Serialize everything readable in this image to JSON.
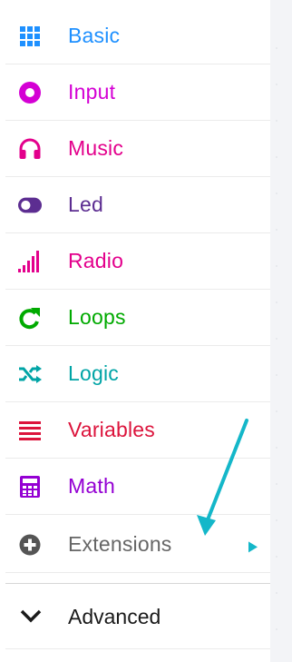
{
  "toolbox": {
    "categories": [
      {
        "label": "Basic",
        "color": "#1e90ff",
        "icon": "grid-icon"
      },
      {
        "label": "Input",
        "color": "#d400d4",
        "icon": "input-circle-icon"
      },
      {
        "label": "Music",
        "color": "#e3008c",
        "icon": "headphones-icon"
      },
      {
        "label": "Led",
        "color": "#5c2d91",
        "icon": "toggle-icon"
      },
      {
        "label": "Radio",
        "color": "#e3008c",
        "icon": "signal-bars-icon"
      },
      {
        "label": "Loops",
        "color": "#00aa00",
        "icon": "loop-arrow-icon"
      },
      {
        "label": "Logic",
        "color": "#00a4a6",
        "icon": "shuffle-icon"
      },
      {
        "label": "Variables",
        "color": "#dc143c",
        "icon": "list-lines-icon"
      },
      {
        "label": "Math",
        "color": "#9400d3",
        "icon": "calculator-icon"
      },
      {
        "label": "Extensions",
        "color": "#666666",
        "icon": "plus-circle-icon"
      }
    ],
    "advanced": {
      "label": "Advanced",
      "icon": "chevron-down-icon"
    }
  },
  "annotation": {
    "color": "#14b7c9",
    "icon": "cyan-arrow-annotation"
  }
}
